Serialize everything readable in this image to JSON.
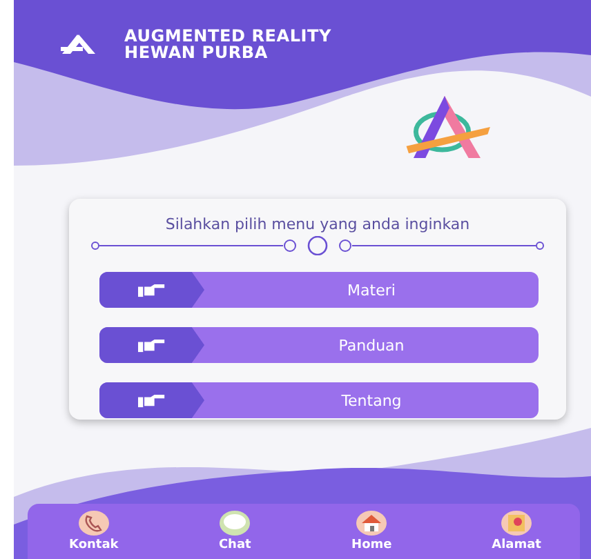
{
  "header": {
    "title_lines": [
      "AUGMENTED REALITY",
      "HEWAN PURBA"
    ]
  },
  "menu_card": {
    "prompt": "Silahkan pilih menu yang anda inginkan",
    "buttons": [
      {
        "label": "Materi"
      },
      {
        "label": "Panduan"
      },
      {
        "label": "Tentang"
      }
    ]
  },
  "bottom_nav": [
    {
      "label": "Kontak",
      "kind": "phone"
    },
    {
      "label": "Chat",
      "kind": "chat"
    },
    {
      "label": "Home",
      "kind": "home"
    },
    {
      "label": "Alamat",
      "kind": "map"
    }
  ]
}
